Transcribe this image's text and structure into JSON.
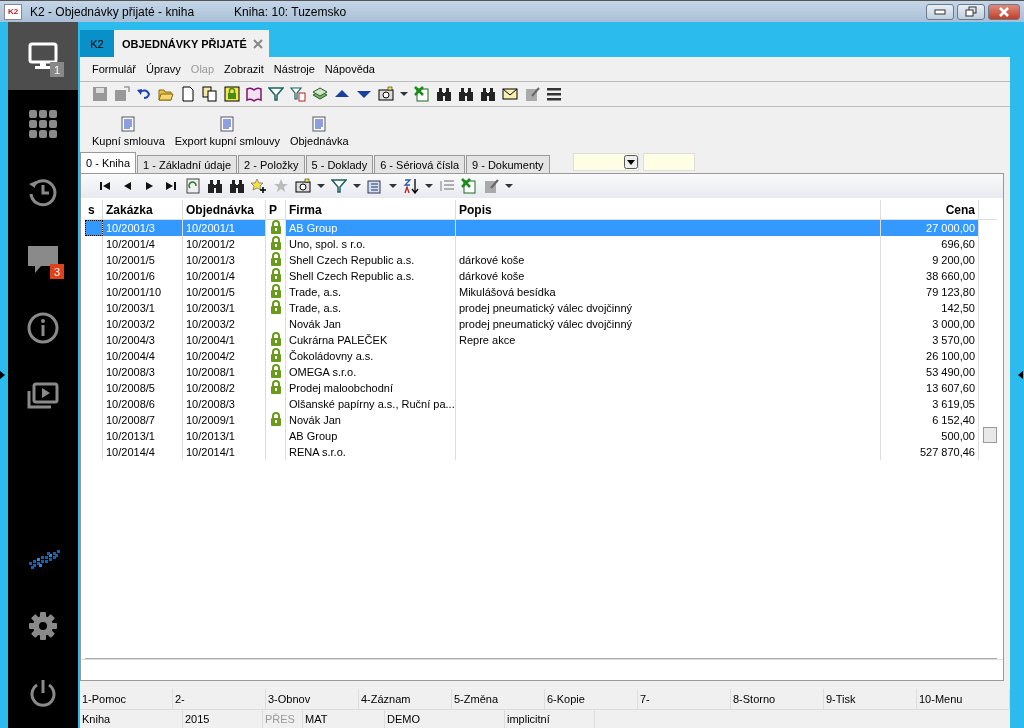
{
  "window": {
    "title": "K2 - Objednávky přijaté - kniha",
    "book": "Kniha: 10: Tuzemsko",
    "app_badge": "K2"
  },
  "sidebar": {
    "items": [
      {
        "kind": "monitor",
        "selected": true,
        "badge": "1"
      },
      {
        "kind": "apps",
        "selected": false
      },
      {
        "kind": "history",
        "selected": false
      },
      {
        "kind": "chat",
        "selected": false,
        "badge": "3"
      },
      {
        "kind": "info",
        "selected": false
      },
      {
        "kind": "media",
        "selected": false
      }
    ],
    "bottom": [
      {
        "kind": "logo"
      },
      {
        "kind": "settings"
      },
      {
        "kind": "power"
      }
    ]
  },
  "doc_tabs": [
    {
      "label": "K2",
      "kind": "home",
      "selected": false
    },
    {
      "label": "OBJEDNÁVKY PŘIJATÉ",
      "kind": "doc",
      "selected": true
    }
  ],
  "menu": [
    {
      "label": "Formulář",
      "disabled": false
    },
    {
      "label": "Úpravy",
      "disabled": false
    },
    {
      "label": "Olap",
      "disabled": true
    },
    {
      "label": "Zobrazit",
      "disabled": false
    },
    {
      "label": "Nástroje",
      "disabled": false
    },
    {
      "label": "Nápověda",
      "disabled": false
    }
  ],
  "actions": [
    "Kupní smlouva",
    "Export kupní smlouvy",
    "Objednávka"
  ],
  "tabs": [
    {
      "label": "0 - Kniha",
      "selected": true
    },
    {
      "label": "1 - Základní údaje",
      "selected": false
    },
    {
      "label": "2 - Položky",
      "selected": false
    },
    {
      "label": "5 - Doklady",
      "selected": false
    },
    {
      "label": "6 - Sériová čísla",
      "selected": false
    },
    {
      "label": "9 - Dokumenty",
      "selected": false
    }
  ],
  "table": {
    "columns": [
      "s",
      "Zakázka",
      "Objednávka",
      "P",
      "Firma",
      "Popis",
      "Cena"
    ],
    "rows": [
      {
        "zakazka": "10/2001/3",
        "objednavka": "10/2001/1",
        "locked": true,
        "firma": "AB Group",
        "popis": "",
        "cena": "27 000,00",
        "selected": true
      },
      {
        "zakazka": "10/2001/4",
        "objednavka": "10/2001/2",
        "locked": true,
        "firma": "Uno, spol. s r.o.",
        "popis": "",
        "cena": "696,60",
        "selected": false
      },
      {
        "zakazka": "10/2001/5",
        "objednavka": "10/2001/3",
        "locked": true,
        "firma": "Shell Czech Republic a.s.",
        "popis": "dárkové koše",
        "cena": "9 200,00",
        "selected": false
      },
      {
        "zakazka": "10/2001/6",
        "objednavka": "10/2001/4",
        "locked": true,
        "firma": "Shell Czech Republic a.s.",
        "popis": "dárkové koše",
        "cena": "38 660,00",
        "selected": false
      },
      {
        "zakazka": "10/2001/10",
        "objednavka": "10/2001/5",
        "locked": true,
        "firma": "Trade, a.s.",
        "popis": "Mikulášová besídka",
        "cena": "79 123,80",
        "selected": false
      },
      {
        "zakazka": "10/2003/1",
        "objednavka": "10/2003/1",
        "locked": true,
        "firma": "Trade, a.s.",
        "popis": "prodej pneumatický válec dvojčinný",
        "cena": "142,50",
        "selected": false
      },
      {
        "zakazka": "10/2003/2",
        "objednavka": "10/2003/2",
        "locked": false,
        "firma": "Novák Jan",
        "popis": "prodej pneumatický válec dvojčinný",
        "cena": "3 000,00",
        "selected": false
      },
      {
        "zakazka": "10/2004/3",
        "objednavka": "10/2004/1",
        "locked": true,
        "firma": "Cukrárna PALEČEK",
        "popis": "Repre akce",
        "cena": "3 570,00",
        "selected": false
      },
      {
        "zakazka": "10/2004/4",
        "objednavka": "10/2004/2",
        "locked": true,
        "firma": "Čokoládovny a.s.",
        "popis": "",
        "cena": "26 100,00",
        "selected": false
      },
      {
        "zakazka": "10/2008/3",
        "objednavka": "10/2008/1",
        "locked": true,
        "firma": "OMEGA s.r.o.",
        "popis": "",
        "cena": "53 490,00",
        "selected": false
      },
      {
        "zakazka": "10/2008/5",
        "objednavka": "10/2008/2",
        "locked": true,
        "firma": "Prodej maloobchodní",
        "popis": "",
        "cena": "13 607,60",
        "selected": false
      },
      {
        "zakazka": "10/2008/6",
        "objednavka": "10/2008/3",
        "locked": false,
        "firma": "Olšanské papírny a.s., Ruční pa...",
        "popis": "",
        "cena": "3 619,05",
        "selected": false
      },
      {
        "zakazka": "10/2008/7",
        "objednavka": "10/2009/1",
        "locked": true,
        "firma": "Novák Jan",
        "popis": "",
        "cena": "6 152,40",
        "selected": false
      },
      {
        "zakazka": "10/2013/1",
        "objednavka": "10/2013/1",
        "locked": false,
        "firma": "AB Group",
        "popis": "",
        "cena": "500,00",
        "selected": false
      },
      {
        "zakazka": "10/2014/4",
        "objednavka": "10/2014/1",
        "locked": false,
        "firma": "RENA s.r.o.",
        "popis": "",
        "cena": "527 870,46",
        "selected": false
      }
    ]
  },
  "function_keys": [
    "1-Pomoc",
    "2-",
    "3-Obnov",
    "4-Záznam",
    "5-Změna",
    "6-Kopie",
    "7-",
    "8-Storno",
    "9-Tisk",
    "10-Menu"
  ],
  "status_bar": [
    {
      "text": "Kniha",
      "disabled": false
    },
    {
      "text": "2015",
      "disabled": false
    },
    {
      "text": "PŘES",
      "disabled": true
    },
    {
      "text": "MAT",
      "disabled": false
    },
    {
      "text": "DEMO",
      "disabled": false
    },
    {
      "text": "implicitní",
      "disabled": false
    }
  ]
}
